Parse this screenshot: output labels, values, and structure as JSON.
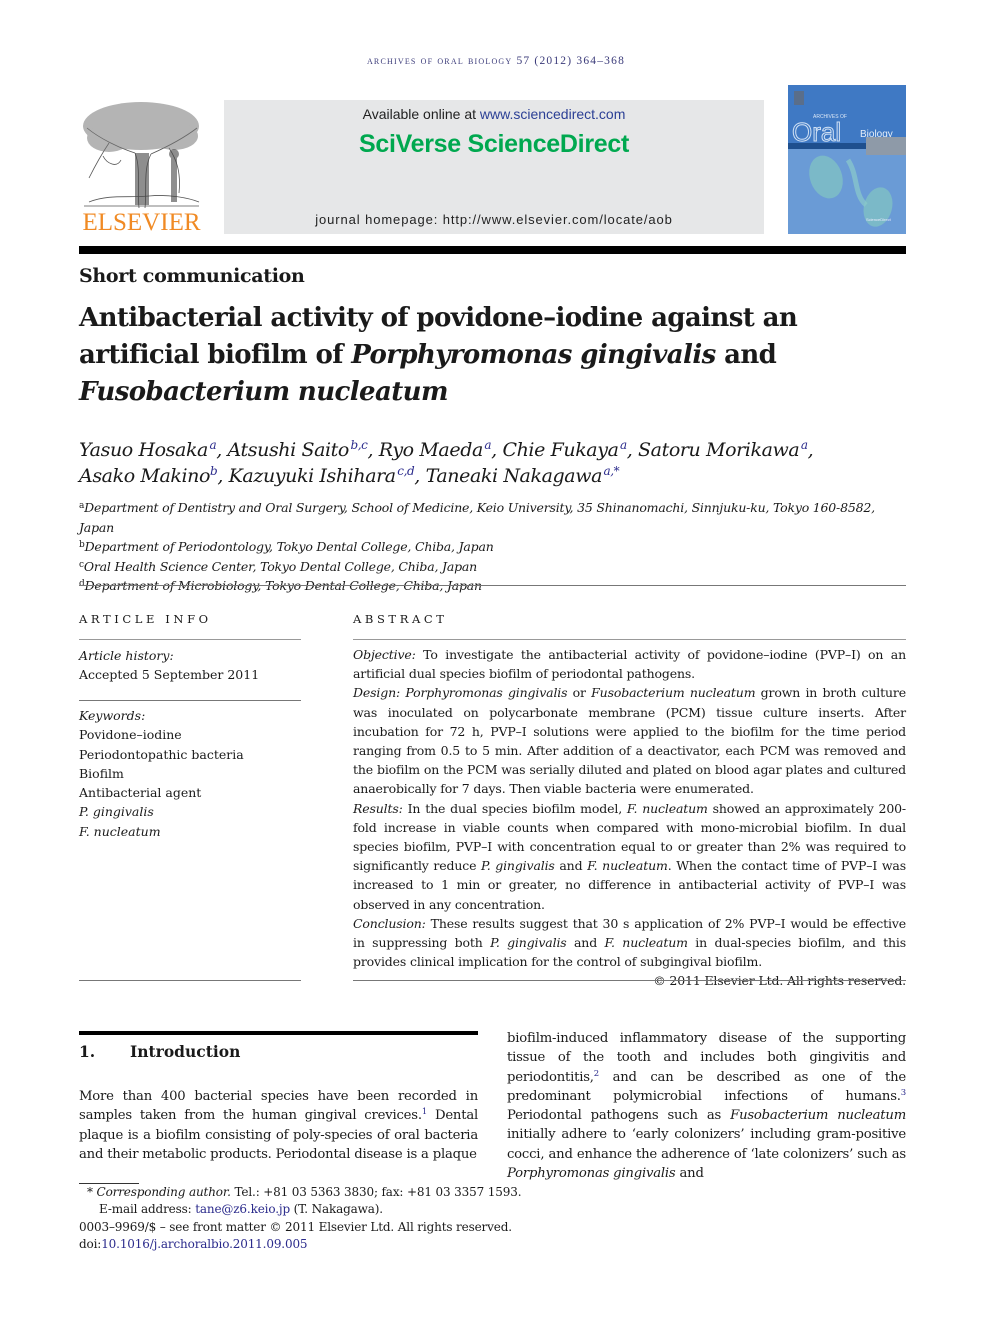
{
  "running_head": "archives of oral biology 57 (2012) 364–368",
  "header": {
    "publisher_logo_text": "ELSEVIER",
    "available_online_prefix": "Available online at ",
    "available_online_link": "www.sciencedirect.com",
    "brand": "SciVerse ScienceDirect",
    "journal_homepage": "journal homepage: http://www.elsevier.com/locate/aob",
    "cover": {
      "title_small": "ARCHIVES OF",
      "title_big": "Oral",
      "title_sub": "Biology",
      "badge": "ScienceDirect"
    }
  },
  "colors": {
    "elsevier_orange": "#f08a24",
    "sciencedirect_green": "#00a84f",
    "link_blue": "#2b3f95",
    "header_box_gray": "#e6e7e8",
    "cover_blue": "#4f86c8"
  },
  "article": {
    "section_type": "Short communication",
    "title_parts": {
      "line1": "Antibacterial activity of povidone–iodine against an",
      "line2_pre": "artificial biofilm of ",
      "line2_italic": "Porphyromonas gingivalis",
      "line2_post": " and",
      "line3_italic": "Fusobacterium nucleatum"
    },
    "authors": [
      {
        "name": "Yasuo Hosaka",
        "sup": "a"
      },
      {
        "name": "Atsushi Saito",
        "sup": "b,c"
      },
      {
        "name": "Ryo Maeda",
        "sup": "a"
      },
      {
        "name": "Chie Fukaya",
        "sup": "a"
      },
      {
        "name": "Satoru Morikawa",
        "sup": "a"
      },
      {
        "name": "Asako Makino",
        "sup": "b"
      },
      {
        "name": "Kazuyuki Ishihara",
        "sup": "c,d"
      },
      {
        "name": "Taneaki Nakagawa",
        "sup": "a,*"
      }
    ],
    "affiliations": [
      {
        "key": "a",
        "text": "Department of Dentistry and Oral Surgery, School of Medicine, Keio University, 35 Shinanomachi, Sinnjuku-ku, Tokyo 160-8582, Japan"
      },
      {
        "key": "b",
        "text": "Department of Periodontology, Tokyo Dental College, Chiba, Japan"
      },
      {
        "key": "c",
        "text": "Oral Health Science Center, Tokyo Dental College, Chiba, Japan"
      },
      {
        "key": "d",
        "text": "Department of Microbiology, Tokyo Dental College, Chiba, Japan"
      }
    ]
  },
  "article_info": {
    "heading": "ARTICLE INFO",
    "history_label": "Article history:",
    "history": "Accepted 5 September 2011",
    "keywords_label": "Keywords:",
    "keywords": [
      "Povidone–iodine",
      "Periodontopathic bacteria",
      "Biofilm",
      "Antibacterial agent",
      "P. gingivalis",
      "F. nucleatum"
    ]
  },
  "abstract": {
    "heading": "ABSTRACT",
    "objective_label": "Objective:",
    "objective": "  To investigate the antibacterial activity of povidone–iodine (PVP–I) on an artificial dual species biofilm of periodontal pathogens.",
    "design_label": "Design:",
    "design_sp1": "Porphyromonas gingivalis",
    "design_or": " or ",
    "design_sp2": "Fusobacterium nucleatum",
    "design": " grown in broth culture was inoculated on polycarbonate membrane (PCM) tissue culture inserts. After incubation for 72 h, PVP–I solutions were applied to the biofilm for the time period ranging from 0.5 to 5 min. After addition of a deactivator, each PCM was removed and the biofilm on the PCM was serially diluted and plated on blood agar plates and cultured anaerobically for 7 days. Then viable bacteria were enumerated.",
    "results_label": "Results:",
    "results_1": " In the dual species biofilm model, ",
    "results_sp1": "F. nucleatum",
    "results_2": " showed an approximately 200-fold increase in viable counts when compared with mono-microbial biofilm. In dual species biofilm, PVP–I with concentration equal to or greater than 2% was required to significantly reduce ",
    "results_sp2": "P. gingivalis",
    "results_3": " and ",
    "results_sp3": "F. nucleatum",
    "results_4": ". When the contact time of PVP–I was increased to 1 min or greater, no difference in antibacterial activity of PVP–I was observed in any concentration.",
    "conclusion_label": "Conclusion:",
    "conclusion_1": " These results suggest that 30 s application of 2% PVP–I would be effective in suppressing both ",
    "conclusion_sp1": "P. gingivalis",
    "conclusion_2": " and ",
    "conclusion_sp2": "F. nucleatum",
    "conclusion_3": " in dual-species biofilm, and this provides clinical implication for the control of subgingival biofilm.",
    "copyright": "© 2011 Elsevier Ltd. All rights reserved."
  },
  "introduction": {
    "number": "1.",
    "heading": "Introduction",
    "left_1": "More than 400 bacterial species have been recorded in samples taken from the human gingival crevices.",
    "ref1": "1",
    "left_2": " Dental plaque is a biofilm consisting of poly-species of oral bacteria and their metabolic products. Periodontal disease is a plaque",
    "right_1": "biofilm-induced inflammatory disease of the supporting tissue of the tooth and includes both gingivitis and periodontitis,",
    "ref2": "2",
    "right_2": " and can be described as one of the predominant polymicrobial infections of humans.",
    "ref3": "3",
    "right_3": " Periodontal pathogens such as ",
    "right_sp1": "Fuso­bacterium nucleatum",
    "right_4": " initially adhere to ‘early colonizers’ including gram-positive cocci, and enhance the adherence of ‘late colonizers’ such as ",
    "right_sp2": "Porphyromonas gingivalis",
    "right_5": " and"
  },
  "footnotes": {
    "star": "*",
    "corr_label": "Corresponding author.",
    "corr_contact": " Tel.: +81 03 5363 3830; fax: +81 03 3357 1593.",
    "email_label": "E-mail address: ",
    "email": "tane@z6.keio.jp",
    "email_suffix": " (T. Nakagawa).",
    "front_matter": "0003–9969/$ – see front matter © 2011 Elsevier Ltd. All rights reserved.",
    "doi_label": "doi:",
    "doi": "10.1016/j.archoralbio.2011.09.005"
  }
}
